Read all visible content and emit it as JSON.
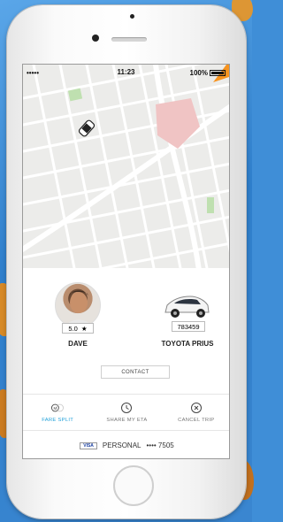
{
  "status_bar": {
    "signal": "•••••",
    "time": "11:23",
    "battery": "100%"
  },
  "driver": {
    "name": "DAVE",
    "rating": "5.0",
    "star": "★"
  },
  "vehicle": {
    "model": "TOYOTA PRIUS",
    "plate": "783459"
  },
  "contact_label": "CONTACT",
  "actions": [
    {
      "label": "FARE SPLIT",
      "icon": "fare-split-icon",
      "active": true
    },
    {
      "label": "SHARE MY ETA",
      "icon": "clock-icon",
      "active": false
    },
    {
      "label": "CANCEL TRIP",
      "icon": "close-circle-icon",
      "active": false
    }
  ],
  "payment": {
    "card_brand": "VISA",
    "profile": "PERSONAL",
    "masked": "•••• 7505"
  },
  "colors": {
    "accent": "#21a1d9",
    "route": "#f7931e"
  }
}
